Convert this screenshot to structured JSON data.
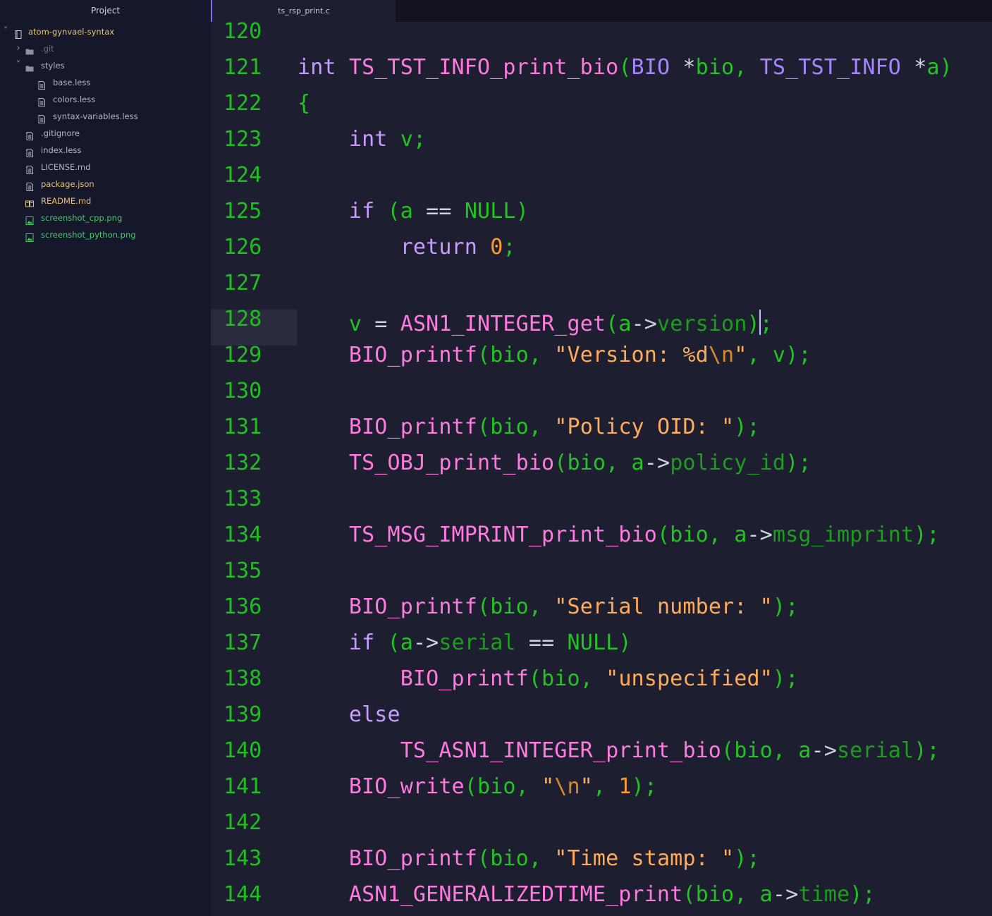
{
  "sidebar": {
    "title": "Project",
    "items": [
      {
        "label": "atom-gynvael-syntax",
        "depth": 0,
        "kind": "repo",
        "chevron": "chevron-down",
        "color": "root"
      },
      {
        "label": ".git",
        "depth": 1,
        "kind": "folder",
        "chevron": "chevron-right",
        "color": "dim"
      },
      {
        "label": "styles",
        "depth": 1,
        "kind": "folder",
        "chevron": "chevron-down",
        "color": "normal"
      },
      {
        "label": "base.less",
        "depth": 2,
        "kind": "file",
        "color": "normal"
      },
      {
        "label": "colors.less",
        "depth": 2,
        "kind": "file",
        "color": "normal"
      },
      {
        "label": "syntax-variables.less",
        "depth": 2,
        "kind": "file",
        "color": "normal"
      },
      {
        "label": ".gitignore",
        "depth": 1,
        "kind": "file",
        "color": "normal"
      },
      {
        "label": "index.less",
        "depth": 1,
        "kind": "file",
        "color": "normal"
      },
      {
        "label": "LICENSE.md",
        "depth": 1,
        "kind": "file",
        "color": "normal"
      },
      {
        "label": "package.json",
        "depth": 1,
        "kind": "file",
        "color": "modified"
      },
      {
        "label": "README.md",
        "depth": 1,
        "kind": "book",
        "color": "modified"
      },
      {
        "label": "screenshot_cpp.png",
        "depth": 1,
        "kind": "image",
        "color": "new"
      },
      {
        "label": "screenshot_python.png",
        "depth": 1,
        "kind": "image",
        "color": "new"
      }
    ]
  },
  "tabs": [
    {
      "label": "ts_rsp_print.c",
      "active": true
    }
  ],
  "editor": {
    "cursor_line": 128,
    "lines": [
      {
        "n": "120",
        "tokens": []
      },
      {
        "n": "121",
        "tokens": [
          [
            "kw",
            "int"
          ],
          [
            "sp",
            " "
          ],
          [
            "fn",
            "TS_TST_INFO_print_bio"
          ],
          [
            "punc",
            "("
          ],
          [
            "type",
            "BIO"
          ],
          [
            "sp",
            " "
          ],
          [
            "op",
            "*"
          ],
          [
            "id",
            "bio"
          ],
          [
            "punc",
            ","
          ],
          [
            "sp",
            " "
          ],
          [
            "type",
            "TS_TST_INFO"
          ],
          [
            "sp",
            " "
          ],
          [
            "op",
            "*"
          ],
          [
            "id",
            "a"
          ],
          [
            "punc",
            ")"
          ]
        ]
      },
      {
        "n": "122",
        "tokens": [
          [
            "punc",
            "{"
          ]
        ]
      },
      {
        "n": "123",
        "tokens": [
          [
            "sp",
            "    "
          ],
          [
            "kw",
            "int"
          ],
          [
            "sp",
            " "
          ],
          [
            "id",
            "v"
          ],
          [
            "punc",
            ";"
          ]
        ]
      },
      {
        "n": "124",
        "tokens": []
      },
      {
        "n": "125",
        "tokens": [
          [
            "sp",
            "    "
          ],
          [
            "kw",
            "if"
          ],
          [
            "sp",
            " "
          ],
          [
            "punc",
            "("
          ],
          [
            "id",
            "a"
          ],
          [
            "sp",
            " "
          ],
          [
            "op",
            "=="
          ],
          [
            "sp",
            " "
          ],
          [
            "id",
            "NULL"
          ],
          [
            "punc",
            ")"
          ]
        ]
      },
      {
        "n": "126",
        "tokens": [
          [
            "sp",
            "        "
          ],
          [
            "kw",
            "return"
          ],
          [
            "sp",
            " "
          ],
          [
            "num",
            "0"
          ],
          [
            "punc",
            ";"
          ]
        ]
      },
      {
        "n": "127",
        "tokens": []
      },
      {
        "n": "128",
        "tokens": [
          [
            "sp",
            "    "
          ],
          [
            "id",
            "v"
          ],
          [
            "sp",
            " "
          ],
          [
            "op",
            "="
          ],
          [
            "sp",
            " "
          ],
          [
            "fn",
            "ASN1_INTEGER_get"
          ],
          [
            "punc",
            "("
          ],
          [
            "id",
            "a"
          ],
          [
            "op",
            "->"
          ],
          [
            "mem",
            "version"
          ],
          [
            "punc",
            ")"
          ],
          [
            "caret",
            ""
          ],
          [
            "punc",
            ";"
          ]
        ]
      },
      {
        "n": "129",
        "tokens": [
          [
            "sp",
            "    "
          ],
          [
            "fn",
            "BIO_printf"
          ],
          [
            "punc",
            "("
          ],
          [
            "id",
            "bio"
          ],
          [
            "punc",
            ","
          ],
          [
            "sp",
            " "
          ],
          [
            "str",
            "\"Version: %d"
          ],
          [
            "esc",
            "\\n"
          ],
          [
            "str",
            "\""
          ],
          [
            "punc",
            ","
          ],
          [
            "sp",
            " "
          ],
          [
            "id",
            "v"
          ],
          [
            "punc",
            ");"
          ]
        ]
      },
      {
        "n": "130",
        "tokens": []
      },
      {
        "n": "131",
        "tokens": [
          [
            "sp",
            "    "
          ],
          [
            "fn",
            "BIO_printf"
          ],
          [
            "punc",
            "("
          ],
          [
            "id",
            "bio"
          ],
          [
            "punc",
            ","
          ],
          [
            "sp",
            " "
          ],
          [
            "str",
            "\"Policy OID: \""
          ],
          [
            "punc",
            ");"
          ]
        ]
      },
      {
        "n": "132",
        "tokens": [
          [
            "sp",
            "    "
          ],
          [
            "fn",
            "TS_OBJ_print_bio"
          ],
          [
            "punc",
            "("
          ],
          [
            "id",
            "bio"
          ],
          [
            "punc",
            ","
          ],
          [
            "sp",
            " "
          ],
          [
            "id",
            "a"
          ],
          [
            "op",
            "->"
          ],
          [
            "mem",
            "policy_id"
          ],
          [
            "punc",
            ");"
          ]
        ]
      },
      {
        "n": "133",
        "tokens": []
      },
      {
        "n": "134",
        "tokens": [
          [
            "sp",
            "    "
          ],
          [
            "fn",
            "TS_MSG_IMPRINT_print_bio"
          ],
          [
            "punc",
            "("
          ],
          [
            "id",
            "bio"
          ],
          [
            "punc",
            ","
          ],
          [
            "sp",
            " "
          ],
          [
            "id",
            "a"
          ],
          [
            "op",
            "->"
          ],
          [
            "mem",
            "msg_imprint"
          ],
          [
            "punc",
            ");"
          ]
        ]
      },
      {
        "n": "135",
        "tokens": []
      },
      {
        "n": "136",
        "tokens": [
          [
            "sp",
            "    "
          ],
          [
            "fn",
            "BIO_printf"
          ],
          [
            "punc",
            "("
          ],
          [
            "id",
            "bio"
          ],
          [
            "punc",
            ","
          ],
          [
            "sp",
            " "
          ],
          [
            "str",
            "\"Serial number: \""
          ],
          [
            "punc",
            ");"
          ]
        ]
      },
      {
        "n": "137",
        "tokens": [
          [
            "sp",
            "    "
          ],
          [
            "kw",
            "if"
          ],
          [
            "sp",
            " "
          ],
          [
            "punc",
            "("
          ],
          [
            "id",
            "a"
          ],
          [
            "op",
            "->"
          ],
          [
            "mem",
            "serial"
          ],
          [
            "sp",
            " "
          ],
          [
            "op",
            "=="
          ],
          [
            "sp",
            " "
          ],
          [
            "id",
            "NULL"
          ],
          [
            "punc",
            ")"
          ]
        ]
      },
      {
        "n": "138",
        "tokens": [
          [
            "sp",
            "        "
          ],
          [
            "fn",
            "BIO_printf"
          ],
          [
            "punc",
            "("
          ],
          [
            "id",
            "bio"
          ],
          [
            "punc",
            ","
          ],
          [
            "sp",
            " "
          ],
          [
            "str",
            "\"unspecified\""
          ],
          [
            "punc",
            ");"
          ]
        ]
      },
      {
        "n": "139",
        "tokens": [
          [
            "sp",
            "    "
          ],
          [
            "kw",
            "else"
          ]
        ]
      },
      {
        "n": "140",
        "tokens": [
          [
            "sp",
            "        "
          ],
          [
            "fn",
            "TS_ASN1_INTEGER_print_bio"
          ],
          [
            "punc",
            "("
          ],
          [
            "id",
            "bio"
          ],
          [
            "punc",
            ","
          ],
          [
            "sp",
            " "
          ],
          [
            "id",
            "a"
          ],
          [
            "op",
            "->"
          ],
          [
            "mem",
            "serial"
          ],
          [
            "punc",
            ");"
          ]
        ]
      },
      {
        "n": "141",
        "tokens": [
          [
            "sp",
            "    "
          ],
          [
            "fn",
            "BIO_write"
          ],
          [
            "punc",
            "("
          ],
          [
            "id",
            "bio"
          ],
          [
            "punc",
            ","
          ],
          [
            "sp",
            " "
          ],
          [
            "str",
            "\""
          ],
          [
            "esc",
            "\\n"
          ],
          [
            "str",
            "\""
          ],
          [
            "punc",
            ","
          ],
          [
            "sp",
            " "
          ],
          [
            "num",
            "1"
          ],
          [
            "punc",
            ");"
          ]
        ]
      },
      {
        "n": "142",
        "tokens": []
      },
      {
        "n": "143",
        "tokens": [
          [
            "sp",
            "    "
          ],
          [
            "fn",
            "BIO_printf"
          ],
          [
            "punc",
            "("
          ],
          [
            "id",
            "bio"
          ],
          [
            "punc",
            ","
          ],
          [
            "sp",
            " "
          ],
          [
            "str",
            "\"Time stamp: \""
          ],
          [
            "punc",
            ");"
          ]
        ]
      },
      {
        "n": "144",
        "tokens": [
          [
            "sp",
            "    "
          ],
          [
            "fn",
            "ASN1_GENERALIZEDTIME_print"
          ],
          [
            "punc",
            "("
          ],
          [
            "id",
            "bio"
          ],
          [
            "punc",
            ","
          ],
          [
            "sp",
            " "
          ],
          [
            "id",
            "a"
          ],
          [
            "op",
            "->"
          ],
          [
            "mem",
            "time"
          ],
          [
            "punc",
            ");"
          ]
        ]
      }
    ]
  },
  "colors": {
    "background": "#1d1f30",
    "sidebar": "#15172a",
    "line_number": "#1fbf1f",
    "keyword": "#c79bff",
    "function": "#ff7ae0",
    "type": "#a685ff",
    "identifier": "#22c322",
    "number": "#ff9a2e",
    "string": "#ffab5a",
    "accent": "#7b6ff2"
  }
}
